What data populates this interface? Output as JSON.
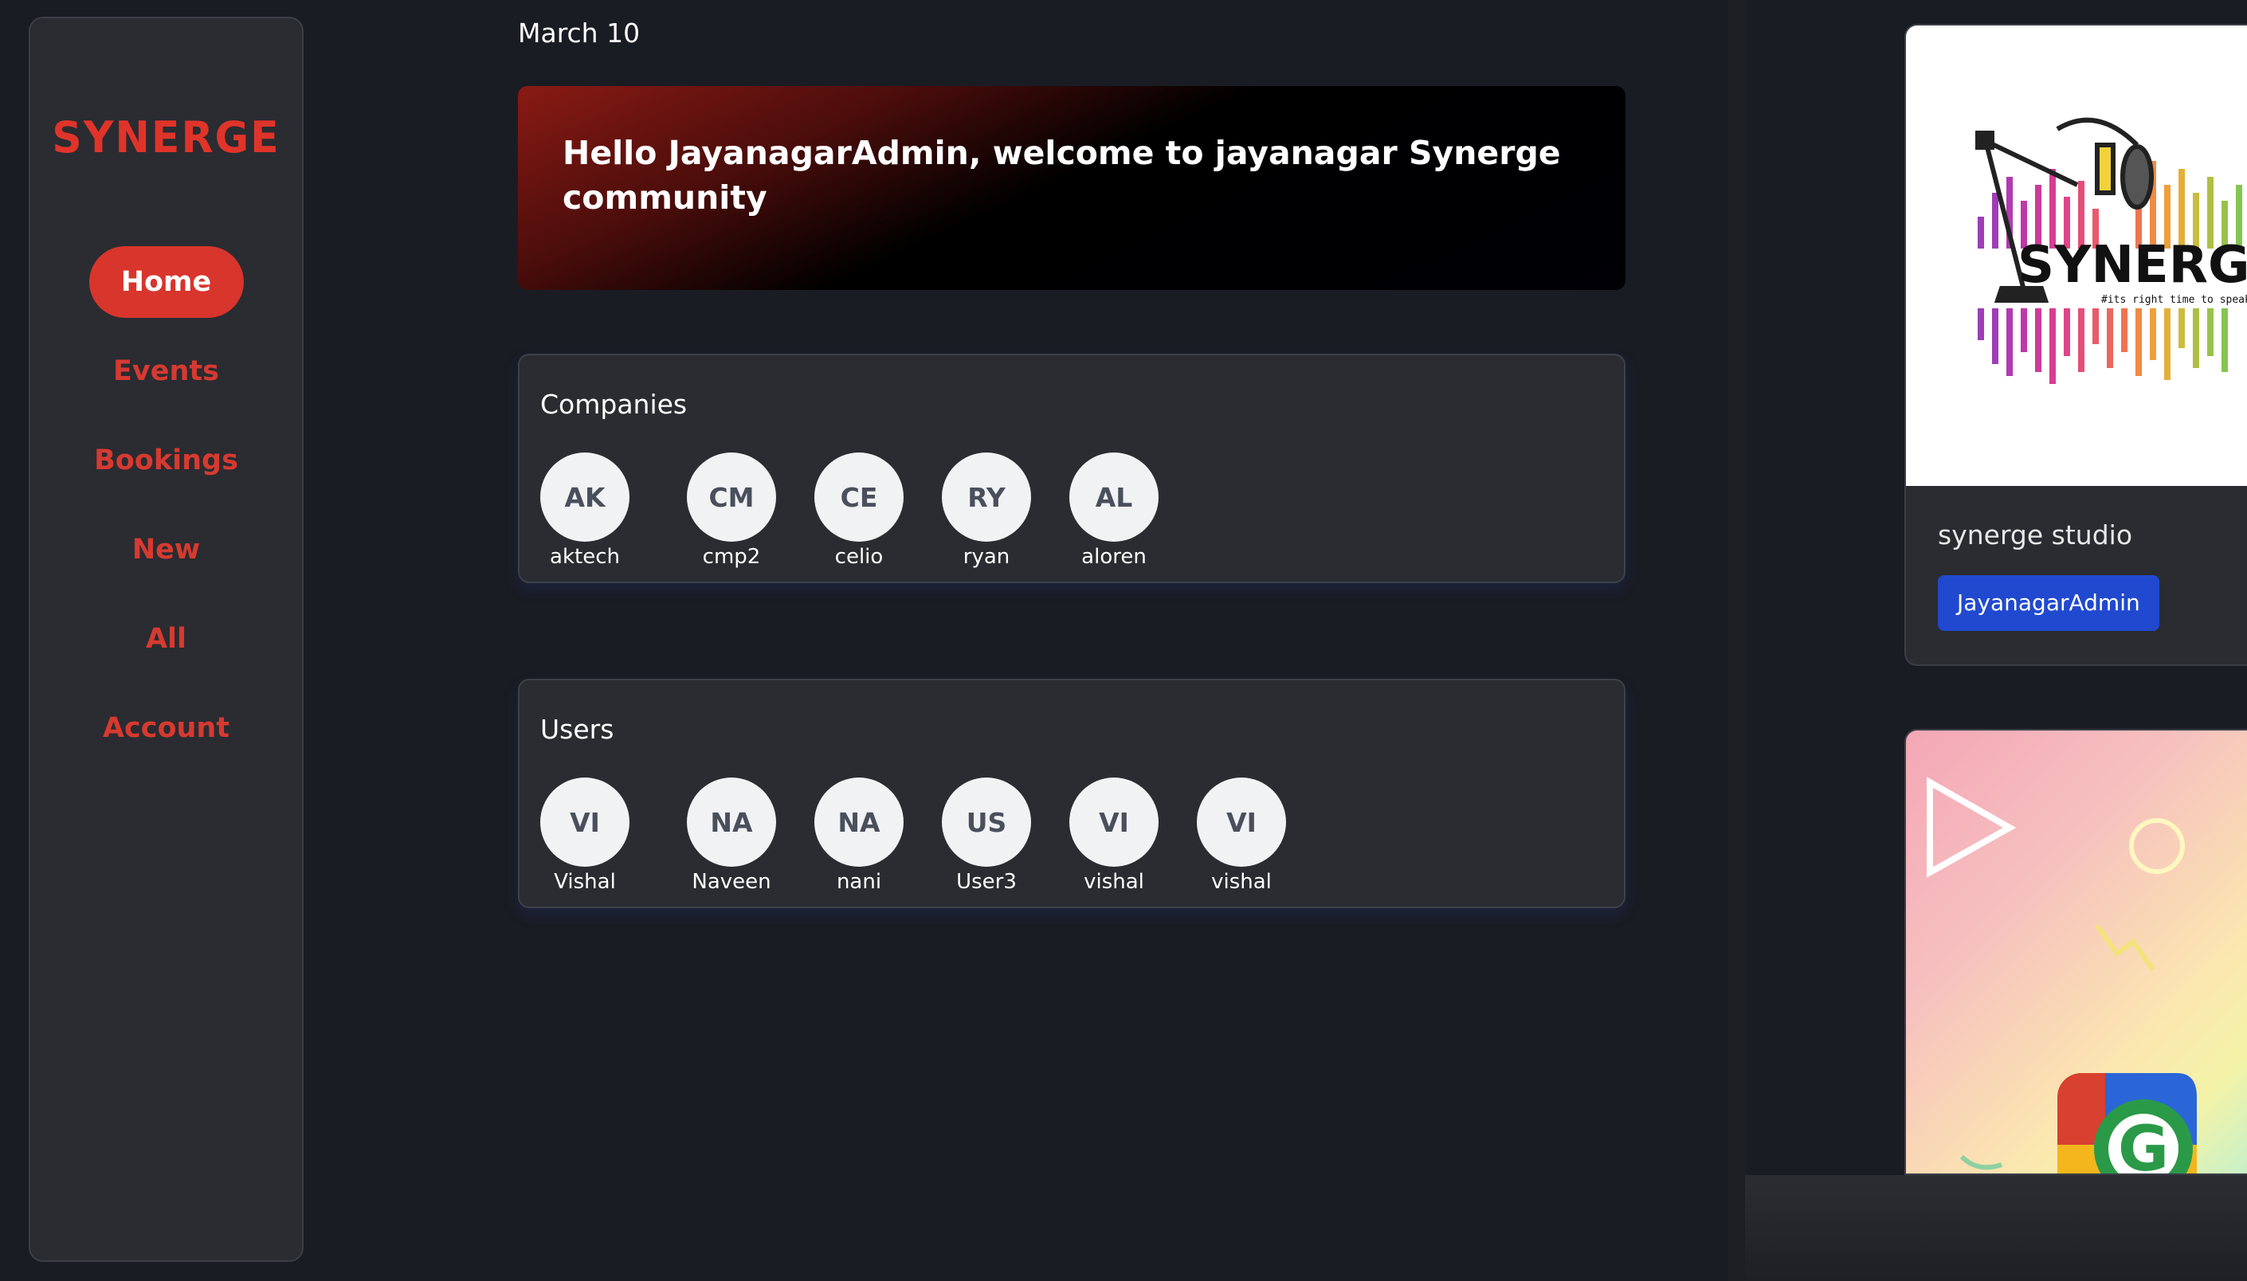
{
  "sidebar": {
    "logo": "SYNERGE",
    "items": [
      {
        "label": "Home",
        "active": true
      },
      {
        "label": "Events",
        "active": false
      },
      {
        "label": "Bookings",
        "active": false
      },
      {
        "label": "New",
        "active": false
      },
      {
        "label": "All",
        "active": false
      },
      {
        "label": "Account",
        "active": false
      }
    ]
  },
  "main": {
    "date": "March 10",
    "welcome": "Hello JayanagarAdmin, welcome to jayanagar Synerge community",
    "companies": {
      "title": "Companies",
      "items": [
        {
          "initials": "AK",
          "name": "aktech"
        },
        {
          "initials": "CM",
          "name": "cmp2"
        },
        {
          "initials": "CE",
          "name": "celio"
        },
        {
          "initials": "RY",
          "name": "ryan"
        },
        {
          "initials": "AL",
          "name": "aloren"
        }
      ]
    },
    "users": {
      "title": "Users",
      "items": [
        {
          "initials": "VI",
          "name": "Vishal"
        },
        {
          "initials": "NA",
          "name": "Naveen"
        },
        {
          "initials": "NA",
          "name": "nani"
        },
        {
          "initials": "US",
          "name": "User3"
        },
        {
          "initials": "VI",
          "name": "vishal"
        },
        {
          "initials": "VI",
          "name": "vishal"
        }
      ]
    }
  },
  "right_panel": {
    "studio": {
      "logo_text": "SYNERGE",
      "tagline": "#its right time to speak",
      "name": "synerge studio",
      "admin_label": "JayanagarAdmin"
    }
  },
  "colors": {
    "accent_red": "#d8352c",
    "button_blue": "#2149cf",
    "background": "#1a1c23",
    "card": "#2a2c31"
  }
}
